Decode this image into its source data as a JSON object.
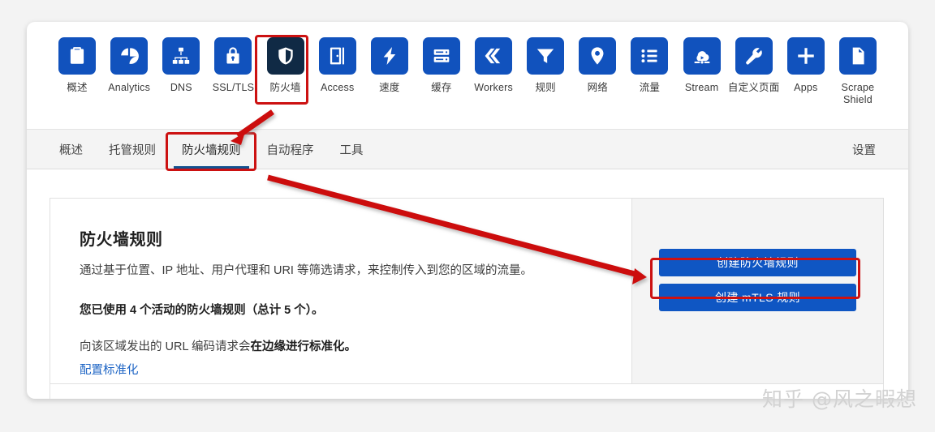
{
  "apps": [
    {
      "label": "概述",
      "icon": "clipboard-icon",
      "active": false
    },
    {
      "label": "Analytics",
      "icon": "pie-chart-icon",
      "active": false
    },
    {
      "label": "DNS",
      "icon": "sitemap-icon",
      "active": false
    },
    {
      "label": "SSL/TLS",
      "icon": "lock-icon",
      "active": false
    },
    {
      "label": "防火墙",
      "icon": "shield-icon",
      "active": true
    },
    {
      "label": "Access",
      "icon": "door-icon",
      "active": false
    },
    {
      "label": "速度",
      "icon": "lightning-icon",
      "active": false
    },
    {
      "label": "缓存",
      "icon": "database-icon",
      "active": false
    },
    {
      "label": "Workers",
      "icon": "chevrons-icon",
      "active": false
    },
    {
      "label": "规则",
      "icon": "funnel-icon",
      "active": false
    },
    {
      "label": "网络",
      "icon": "map-pin-icon",
      "active": false
    },
    {
      "label": "流量",
      "icon": "list-icon",
      "active": false
    },
    {
      "label": "Stream",
      "icon": "cloud-play-icon",
      "active": false
    },
    {
      "label": "自定义页面",
      "icon": "wrench-icon",
      "active": false
    },
    {
      "label": "Apps",
      "icon": "plus-icon",
      "active": false
    },
    {
      "label": "Scrape\nShield",
      "icon": "document-icon",
      "active": false
    }
  ],
  "subnav": {
    "items": [
      {
        "label": "概述",
        "selected": false
      },
      {
        "label": "托管规则",
        "selected": false
      },
      {
        "label": "防火墙规则",
        "selected": true
      },
      {
        "label": "自动程序",
        "selected": false
      },
      {
        "label": "工具",
        "selected": false
      }
    ],
    "settings_label": "设置"
  },
  "panel": {
    "title": "防火墙规则",
    "description": "通过基于位置、IP 地址、用户代理和 URI 等筛选请求，来控制传入到您的区域的流量。",
    "usage": "您已使用 4 个活动的防火墙规则（总计 5 个）。",
    "usage_active_count": "4",
    "usage_total_count": "5",
    "note_prefix": "向该区域发出的 URL 编码请求会",
    "note_bold": "在边缘进行标准化。",
    "link_label": "配置标准化",
    "primary_button": "创建防火墙规则",
    "secondary_button": "创建 mTLS 规则"
  },
  "annotations": {
    "highlight_color": "#cc1111",
    "targets": [
      "防火墙",
      "防火墙规则",
      "创建防火墙规则"
    ]
  },
  "watermark": "知乎 @风之暇想",
  "colors": {
    "tile_blue": "#1152bd",
    "tile_active": "#102a45",
    "button_blue": "#0f56c3",
    "tab_underline": "#13518f",
    "link_blue": "#1b63c4"
  }
}
